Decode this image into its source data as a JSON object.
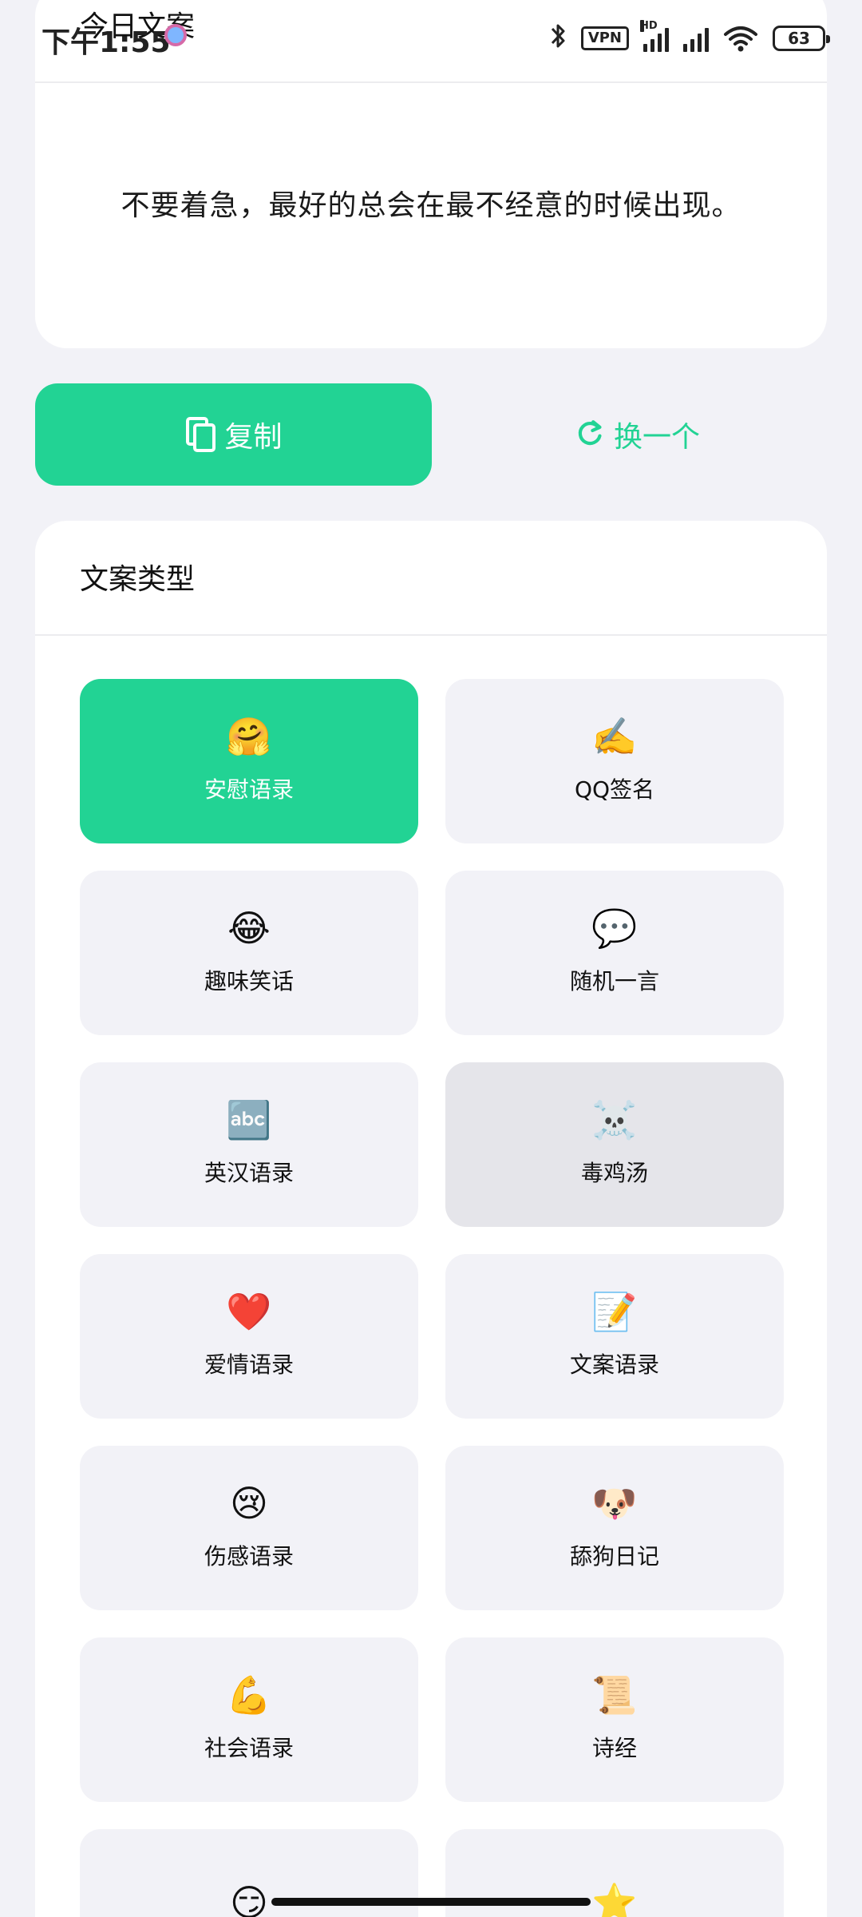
{
  "status_bar": {
    "time": "下午1:55",
    "vpn": "VPN",
    "hd": "HD",
    "battery": "63"
  },
  "quote_card": {
    "title": "今日文案",
    "text": "不要着急，最好的总会在最不经意的时候出现。"
  },
  "actions": {
    "copy_label": "复制",
    "refresh_label": "换一个"
  },
  "categories": {
    "title": "文案类型",
    "items": [
      {
        "emoji": "🤗",
        "label": "安慰语录",
        "icon": "hugging-face-icon"
      },
      {
        "emoji": "✍️",
        "label": "QQ签名",
        "icon": "writing-hand-icon"
      },
      {
        "emoji": "😂",
        "label": "趣味笑话",
        "icon": "laughing-face-icon"
      },
      {
        "emoji": "💬",
        "label": "随机一言",
        "icon": "speech-bubble-icon"
      },
      {
        "emoji": "🔤",
        "label": "英汉语录",
        "icon": "abc-icon"
      },
      {
        "emoji": "☠️",
        "label": "毒鸡汤",
        "icon": "skull-icon"
      },
      {
        "emoji": "❤️",
        "label": "爱情语录",
        "icon": "heart-icon"
      },
      {
        "emoji": "📝",
        "label": "文案语录",
        "icon": "memo-icon"
      },
      {
        "emoji": "😢",
        "label": "伤感语录",
        "icon": "crying-face-icon"
      },
      {
        "emoji": "🐶",
        "label": "舔狗日记",
        "icon": "dog-face-icon"
      },
      {
        "emoji": "💪",
        "label": "社会语录",
        "icon": "flexed-biceps-icon"
      },
      {
        "emoji": "📜",
        "label": "诗经",
        "icon": "scroll-icon"
      },
      {
        "emoji": "😏",
        "label": "",
        "icon": "smirk-face-icon"
      },
      {
        "emoji": "⭐",
        "label": "",
        "icon": "star-icon"
      }
    ]
  },
  "colors": {
    "accent": "#22d394",
    "background": "#f2f2f7",
    "tile": "#f2f2f7",
    "tile_pressed": "#e5e5ea"
  }
}
